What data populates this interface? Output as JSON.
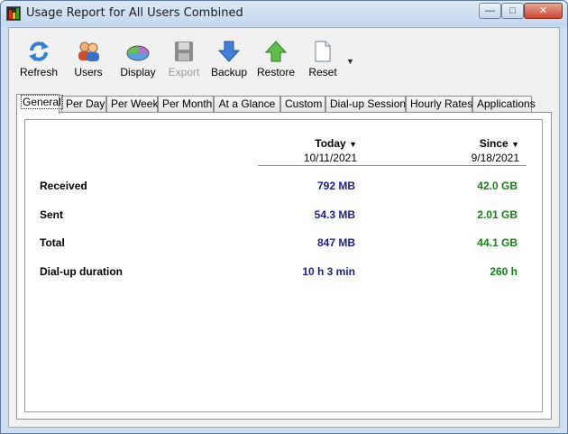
{
  "window": {
    "title": "Usage Report for All Users Combined",
    "controls": {
      "minimize": "—",
      "maximize": "□",
      "close": "✕"
    }
  },
  "toolbar": {
    "buttons": [
      {
        "label": "Refresh",
        "icon": "refresh-icon",
        "enabled": true
      },
      {
        "label": "Users",
        "icon": "users-icon",
        "enabled": true
      },
      {
        "label": "Display",
        "icon": "display-icon",
        "enabled": true
      },
      {
        "label": "Export",
        "icon": "export-icon",
        "enabled": false
      },
      {
        "label": "Backup",
        "icon": "backup-icon",
        "enabled": true
      },
      {
        "label": "Restore",
        "icon": "restore-icon",
        "enabled": true
      },
      {
        "label": "Reset",
        "icon": "reset-icon",
        "enabled": true
      }
    ],
    "dropdown_arrow": "▼"
  },
  "tabs": [
    {
      "label": "General",
      "active": true
    },
    {
      "label": "Per Day",
      "active": false
    },
    {
      "label": "Per Week",
      "active": false
    },
    {
      "label": "Per Month",
      "active": false
    },
    {
      "label": "At a Glance",
      "active": false
    },
    {
      "label": "Custom",
      "active": false
    },
    {
      "label": "Dial-up Sessions",
      "active": false
    },
    {
      "label": "Hourly Rates",
      "active": false
    },
    {
      "label": "Applications",
      "active": false
    }
  ],
  "report": {
    "columns": {
      "today": {
        "heading": "Today",
        "arrow": "▼",
        "date": "10/11/2021"
      },
      "since": {
        "heading": "Since",
        "arrow": "▼",
        "date": "9/18/2021"
      }
    },
    "rows": [
      {
        "label": "Received",
        "today": "792 MB",
        "since": "42.0 GB"
      },
      {
        "label": "Sent",
        "today": "54.3 MB",
        "since": "2.01 GB"
      },
      {
        "label": "Total",
        "today": "847 MB",
        "since": "44.1 GB"
      },
      {
        "label": "Dial-up duration",
        "today": "10 h 3 min",
        "since": "260 h"
      }
    ]
  },
  "colors": {
    "today_value": "#1c1c86",
    "since_value": "#178017",
    "disabled_text": "#9a9a9a"
  }
}
